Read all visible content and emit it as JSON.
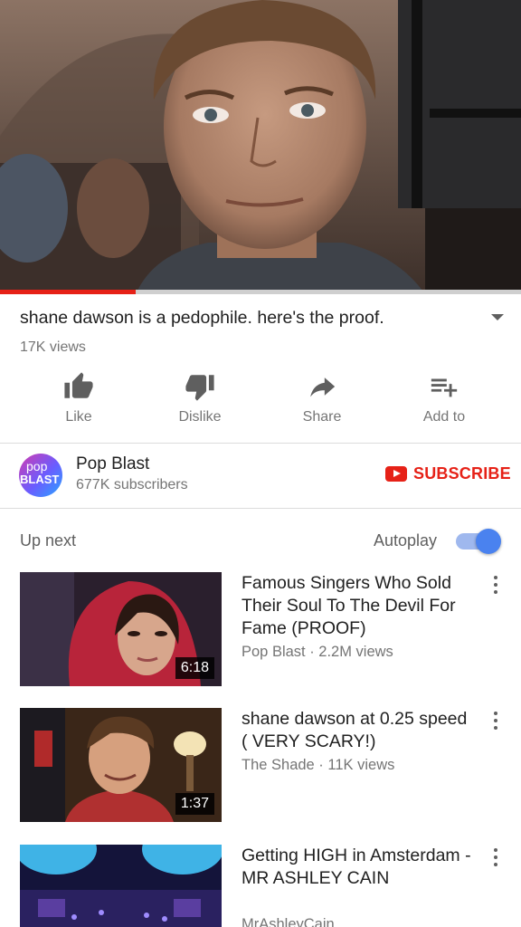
{
  "player": {
    "progress_fraction": 0.26
  },
  "video": {
    "title": "shane dawson is a pedophile. here's the proof.",
    "views": "17K views"
  },
  "actions": [
    {
      "label": "Like",
      "icon": "thumb-up-icon"
    },
    {
      "label": "Dislike",
      "icon": "thumb-down-icon"
    },
    {
      "label": "Share",
      "icon": "share-arrow-icon"
    },
    {
      "label": "Add to",
      "icon": "playlist-add-icon"
    }
  ],
  "channel": {
    "avatar_line1": "pop",
    "avatar_line2": "BLAST",
    "name": "Pop Blast",
    "subscribers": "677K subscribers",
    "subscribe_label": "SUBSCRIBE"
  },
  "up_next": {
    "label": "Up next",
    "autoplay_label": "Autoplay",
    "autoplay_on": true
  },
  "videos": [
    {
      "title": "Famous Singers Who Sold Their Soul To The Devil For Fame (PROOF)",
      "meta": "Pop Blast · 2.2M views",
      "duration": "6:18"
    },
    {
      "title": "shane dawson at 0.25 speed ( VERY SCARY!)",
      "meta": "The Shade · 11K views",
      "duration": "1:37"
    },
    {
      "title": "Getting HIGH in Amsterdam - MR ASHLEY CAIN",
      "meta": "MrAshleyCain",
      "duration": ""
    }
  ],
  "colors": {
    "accent_red": "#e62117",
    "toggle_blue": "#4a82ef",
    "secondary_text": "#757575"
  }
}
